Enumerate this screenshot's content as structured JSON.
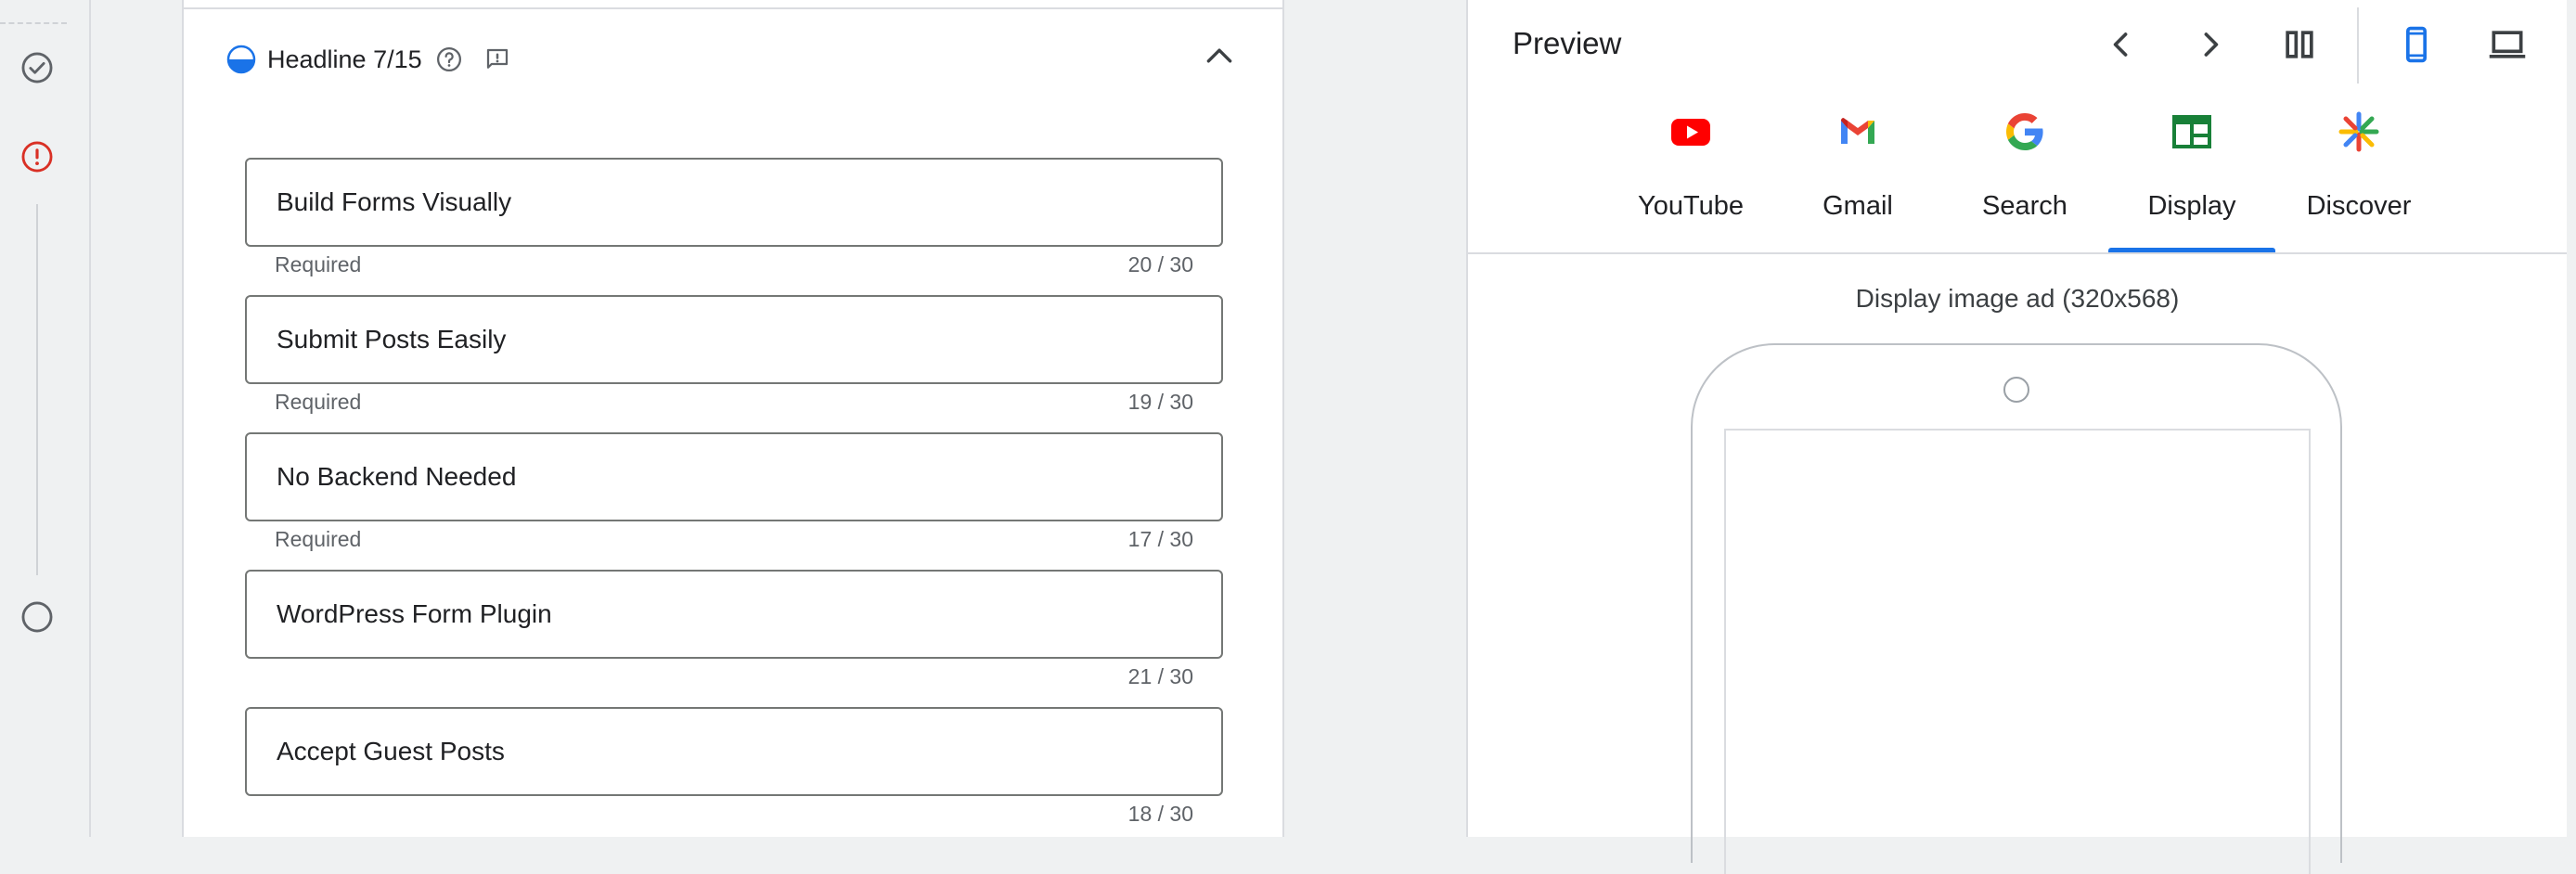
{
  "rail": {
    "steps": [
      {
        "icon": "check-circle-icon",
        "status": "complete"
      },
      {
        "icon": "error-icon",
        "status": "error"
      },
      {
        "icon": "empty-circle-icon",
        "status": "pending"
      }
    ]
  },
  "editor": {
    "section": {
      "title": "Headline 7/15",
      "progress_icon": "half-circle-progress-icon",
      "help_icon": "help-icon",
      "feedback_icon": "feedback-icon",
      "collapse_icon": "chevron-up-icon"
    },
    "headlines": [
      {
        "value": "Build Forms Visually",
        "helper": "Required",
        "count": "20 / 30"
      },
      {
        "value": "Submit Posts Easily",
        "helper": "Required",
        "count": "19 / 30"
      },
      {
        "value": "No Backend Needed",
        "helper": "Required",
        "count": "17 / 30"
      },
      {
        "value": "WordPress Form Plugin",
        "helper": "",
        "count": "21 / 30"
      },
      {
        "value": "Accept Guest Posts",
        "helper": "",
        "count": "18 / 30"
      }
    ]
  },
  "preview": {
    "title": "Preview",
    "toolbar": {
      "prev_icon": "chevron-left-icon",
      "next_icon": "chevron-right-icon",
      "layout_icon": "columns-icon",
      "mobile_icon": "smartphone-icon",
      "desktop_icon": "laptop-icon"
    },
    "tabs": [
      {
        "label": "YouTube",
        "icon": "youtube-icon",
        "active": false
      },
      {
        "label": "Gmail",
        "icon": "gmail-icon",
        "active": false
      },
      {
        "label": "Search",
        "icon": "google-icon",
        "active": false
      },
      {
        "label": "Display",
        "icon": "display-icon",
        "active": true
      },
      {
        "label": "Discover",
        "icon": "discover-icon",
        "active": false
      }
    ],
    "ad_caption": "Display image ad (320x568)"
  },
  "colors": {
    "accent": "#1a73e8",
    "error": "#d93025",
    "display_green": "#188038",
    "youtube_red": "#ff0000"
  }
}
